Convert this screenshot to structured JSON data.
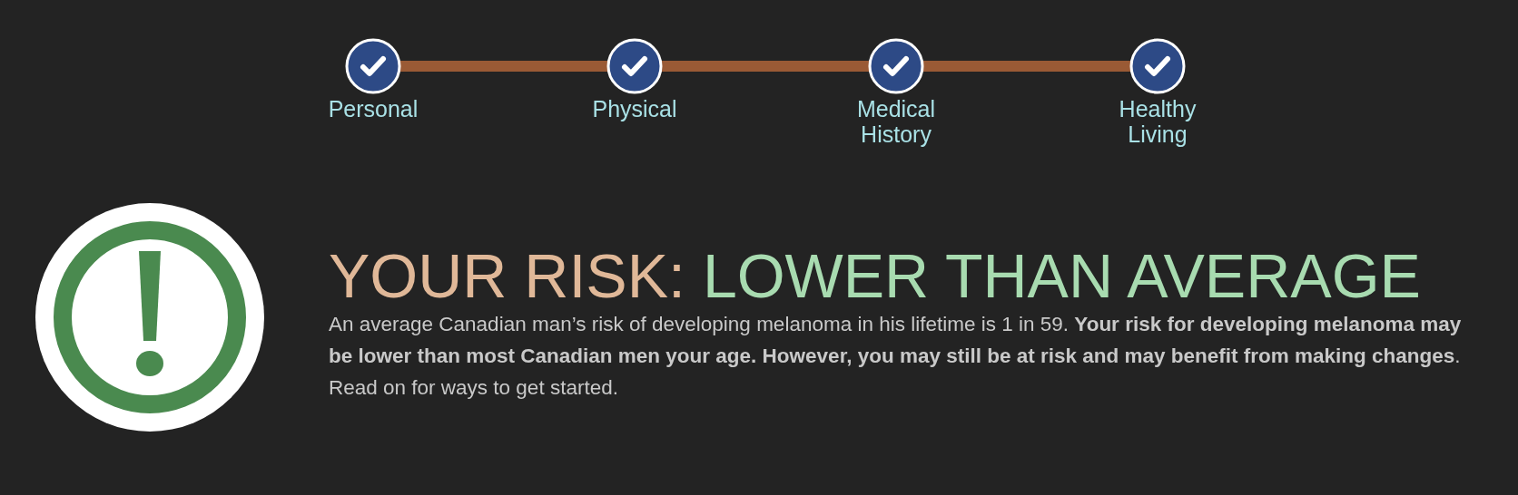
{
  "steps": [
    {
      "label": "Personal",
      "done": true
    },
    {
      "label": "Physical",
      "done": true
    },
    {
      "label": "Medical History",
      "done": true
    },
    {
      "label": "Healthy Living",
      "done": true
    }
  ],
  "result": {
    "heading": "YOUR RISK:",
    "level": "LOWER THAN AVERAGE",
    "description": "An average Canadian man’s risk of developing melanoma in his lifetime is 1 in 59. **Your risk for developing melanoma may be lower than most Canadian men your age. However, you may still be at risk and may benefit from making changes**. Read on for ways to get started."
  }
}
